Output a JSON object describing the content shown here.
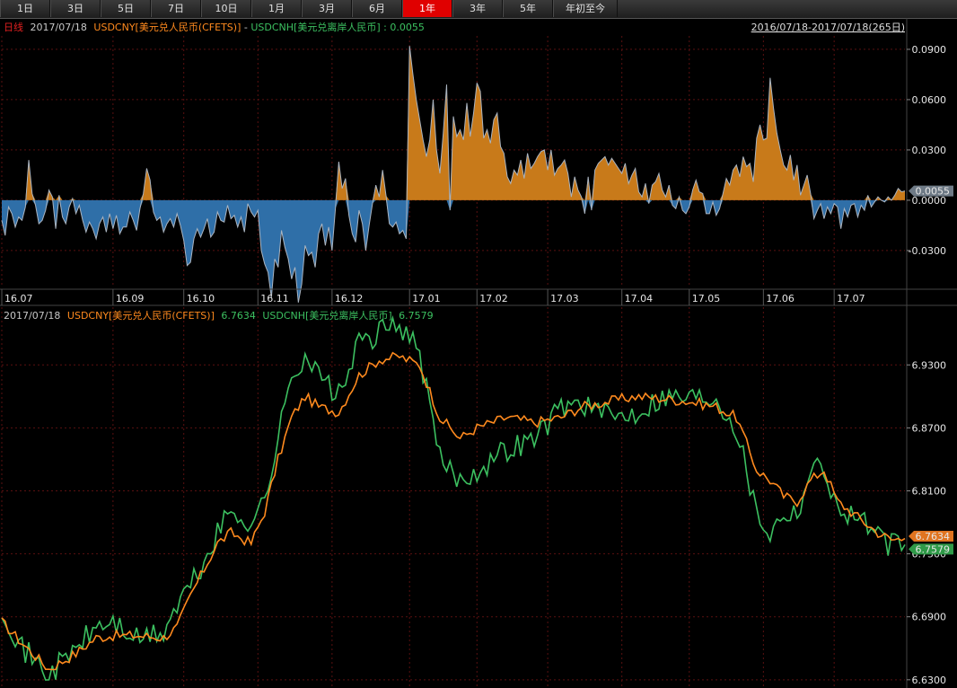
{
  "tabs": [
    {
      "label": "1日"
    },
    {
      "label": "3日"
    },
    {
      "label": "5日"
    },
    {
      "label": "7日"
    },
    {
      "label": "10日"
    },
    {
      "label": "1月"
    },
    {
      "label": "3月"
    },
    {
      "label": "6月"
    },
    {
      "label": "1年",
      "active": true
    },
    {
      "label": "3年"
    },
    {
      "label": "5年"
    },
    {
      "label": "年初至今"
    }
  ],
  "colors": {
    "cny": "#ff8a1e",
    "cnh": "#3cc060",
    "pos": "#c87a1a",
    "neg": "#2f6fa8",
    "red": "#e02020",
    "grid": "#5a1010"
  },
  "chart_data": [
    {
      "type": "area",
      "header": {
        "prefix": "日线",
        "date": "2017/07/18",
        "series_a": "USDCNY[美元兑人民币(CFETS)]",
        "sep": " - ",
        "series_b": "USDCNH[美元兑离岸人民币]",
        "value_text": ": 0.0055",
        "range": "2016/07/18-2017/07/18(265日)"
      },
      "ylim": [
        -0.052,
        0.098
      ],
      "yticks": [
        {
          "v": 0.09,
          "label": "0.0900"
        },
        {
          "v": 0.06,
          "label": "0.0600"
        },
        {
          "v": 0.03,
          "label": "0.0300"
        },
        {
          "v": 0.0,
          "label": "0.0000"
        },
        {
          "v": -0.03,
          "label": "-0.0300"
        }
      ],
      "last_value": {
        "v": 0.0055,
        "label": "0.0055"
      },
      "xticks": [
        {
          "i": 0,
          "label": "16.07"
        },
        {
          "i": 33,
          "label": "16.09"
        },
        {
          "i": 54,
          "label": "16.10"
        },
        {
          "i": 76,
          "label": "16.11"
        },
        {
          "i": 98,
          "label": "16.12"
        },
        {
          "i": 121,
          "label": "17.01"
        },
        {
          "i": 141,
          "label": "17.02"
        },
        {
          "i": 162,
          "label": "17.03"
        },
        {
          "i": 184,
          "label": "17.04"
        },
        {
          "i": 204,
          "label": "17.05"
        },
        {
          "i": 226,
          "label": "17.06"
        },
        {
          "i": 247,
          "label": "17.07"
        }
      ],
      "values": [
        -0.012,
        -0.021,
        -0.004,
        -0.008,
        -0.016,
        -0.01,
        -0.012,
        -0.004,
        0.024,
        0.004,
        -0.003,
        -0.014,
        -0.012,
        -0.006,
        0.006,
        0.002,
        -0.017,
        0.003,
        -0.01,
        -0.014,
        -0.004,
        0.001,
        -0.008,
        -0.003,
        -0.012,
        -0.019,
        -0.013,
        -0.017,
        -0.023,
        -0.014,
        -0.01,
        -0.019,
        -0.008,
        -0.017,
        -0.009,
        -0.02,
        -0.016,
        -0.016,
        -0.007,
        -0.012,
        -0.018,
        -0.005,
        0.004,
        0.019,
        0.012,
        -0.007,
        -0.012,
        -0.01,
        -0.019,
        -0.014,
        -0.011,
        -0.016,
        -0.008,
        -0.015,
        -0.024,
        -0.039,
        -0.037,
        -0.023,
        -0.017,
        -0.022,
        -0.017,
        -0.011,
        -0.022,
        -0.019,
        -0.007,
        -0.012,
        -0.013,
        -0.003,
        -0.011,
        -0.009,
        -0.016,
        -0.01,
        -0.019,
        -0.002,
        -0.007,
        -0.01,
        -0.006,
        -0.03,
        -0.038,
        -0.043,
        -0.058,
        -0.035,
        -0.04,
        -0.018,
        -0.028,
        -0.035,
        -0.047,
        -0.04,
        -0.061,
        -0.05,
        -0.027,
        -0.033,
        -0.031,
        -0.04,
        -0.02,
        -0.014,
        -0.027,
        -0.016,
        -0.03,
        -0.005,
        0.023,
        0.007,
        0.013,
        -0.009,
        -0.02,
        -0.025,
        -0.006,
        -0.014,
        -0.03,
        -0.015,
        -0.002,
        0.009,
        0.002,
        0.018,
        0.003,
        -0.014,
        -0.016,
        -0.013,
        -0.02,
        -0.018,
        -0.023,
        0.092,
        0.075,
        0.06,
        0.048,
        0.036,
        0.026,
        0.036,
        0.06,
        0.03,
        0.016,
        0.04,
        0.069,
        -0.006,
        0.05,
        0.038,
        0.042,
        0.036,
        0.058,
        0.038,
        0.052,
        0.07,
        0.065,
        0.037,
        0.042,
        0.034,
        0.048,
        0.052,
        0.032,
        0.028,
        0.014,
        0.01,
        0.018,
        0.015,
        0.024,
        0.013,
        0.028,
        0.019,
        0.022,
        0.026,
        0.029,
        0.03,
        0.018,
        0.03,
        0.015,
        0.019,
        0.021,
        0.024,
        0.016,
        0.002,
        0.014,
        0.006,
        0.002,
        -0.008,
        0.014,
        -0.006,
        0.018,
        0.022,
        0.024,
        0.026,
        0.021,
        0.025,
        0.022,
        0.019,
        0.016,
        0.022,
        0.01,
        0.015,
        0.019,
        0.005,
        0.002,
        0.01,
        -0.002,
        0.009,
        0.011,
        0.016,
        0.006,
        0.002,
        0.009,
        -0.003,
        -0.005,
        0.002,
        -0.006,
        -0.008,
        -0.004,
        0.006,
        0.012,
        0.005,
        0.004,
        -0.008,
        -0.008,
        -0.001,
        -0.009,
        -0.005,
        0.004,
        0.013,
        0.009,
        0.018,
        0.021,
        0.014,
        0.026,
        0.02,
        0.022,
        0.011,
        0.037,
        0.045,
        0.036,
        0.037,
        0.073,
        0.055,
        0.04,
        0.03,
        0.021,
        0.018,
        0.027,
        0.012,
        0.021,
        0.003,
        0.009,
        0.015,
        0.004,
        -0.011,
        -0.006,
        -0.002,
        -0.011,
        -0.004,
        -0.008,
        -0.002,
        -0.004,
        -0.017,
        -0.005,
        -0.01,
        -0.003,
        -0.002,
        -0.01,
        -0.003,
        -0.006,
        0.003,
        -0.004,
        -0.001,
        0.002,
        0.0,
        -0.001,
        0.002,
        0.0,
        0.003,
        0.007,
        0.005,
        0.0055
      ]
    },
    {
      "type": "line",
      "header": {
        "date": "2017/07/18",
        "series_a_label": "USDCNY[美元兑人民币(CFETS)]",
        "series_a_value": "6.7634",
        "series_b_label": "USDCNH[美元兑离岸人民币]",
        "series_b_value": "6.7579"
      },
      "ylim": [
        6.623,
        6.985
      ],
      "yticks": [
        {
          "v": 6.93,
          "label": "6.9300"
        },
        {
          "v": 6.87,
          "label": "6.8700"
        },
        {
          "v": 6.81,
          "label": "6.8100"
        },
        {
          "v": 6.75,
          "label": "6.7500"
        },
        {
          "v": 6.69,
          "label": "6.6900"
        },
        {
          "v": 6.63,
          "label": "6.6300"
        }
      ],
      "last_values": [
        {
          "v": 6.7634,
          "label": "6.7634",
          "series": "cny"
        },
        {
          "v": 6.7579,
          "label": "6.7579",
          "series": "cnh"
        }
      ],
      "anchors_cny": [
        [
          0,
          6.685
        ],
        [
          6,
          6.665
        ],
        [
          14,
          6.64
        ],
        [
          22,
          6.655
        ],
        [
          28,
          6.67
        ],
        [
          33,
          6.672
        ],
        [
          40,
          6.672
        ],
        [
          48,
          6.67
        ],
        [
          52,
          6.68
        ],
        [
          56,
          6.71
        ],
        [
          60,
          6.735
        ],
        [
          64,
          6.76
        ],
        [
          68,
          6.77
        ],
        [
          74,
          6.76
        ],
        [
          78,
          6.79
        ],
        [
          82,
          6.84
        ],
        [
          86,
          6.88
        ],
        [
          90,
          6.9
        ],
        [
          94,
          6.89
        ],
        [
          100,
          6.885
        ],
        [
          106,
          6.92
        ],
        [
          112,
          6.935
        ],
        [
          118,
          6.938
        ],
        [
          124,
          6.93
        ],
        [
          130,
          6.88
        ],
        [
          136,
          6.86
        ],
        [
          141,
          6.87
        ],
        [
          150,
          6.88
        ],
        [
          158,
          6.875
        ],
        [
          166,
          6.88
        ],
        [
          172,
          6.89
        ],
        [
          180,
          6.895
        ],
        [
          188,
          6.9
        ],
        [
          196,
          6.898
        ],
        [
          204,
          6.895
        ],
        [
          212,
          6.89
        ],
        [
          218,
          6.88
        ],
        [
          224,
          6.83
        ],
        [
          228,
          6.82
        ],
        [
          232,
          6.805
        ],
        [
          236,
          6.8
        ],
        [
          240,
          6.82
        ],
        [
          244,
          6.83
        ],
        [
          248,
          6.8
        ],
        [
          252,
          6.79
        ],
        [
          256,
          6.78
        ],
        [
          260,
          6.77
        ],
        [
          264,
          6.7634
        ]
      ],
      "anchors_cnh": [
        [
          0,
          6.7
        ],
        [
          6,
          6.66
        ],
        [
          14,
          6.635
        ],
        [
          22,
          6.66
        ],
        [
          28,
          6.68
        ],
        [
          33,
          6.685
        ],
        [
          40,
          6.668
        ],
        [
          48,
          6.675
        ],
        [
          52,
          6.7
        ],
        [
          56,
          6.72
        ],
        [
          60,
          6.74
        ],
        [
          64,
          6.77
        ],
        [
          68,
          6.79
        ],
        [
          74,
          6.78
        ],
        [
          78,
          6.8
        ],
        [
          82,
          6.86
        ],
        [
          86,
          6.92
        ],
        [
          90,
          6.94
        ],
        [
          94,
          6.92
        ],
        [
          100,
          6.9
        ],
        [
          106,
          6.95
        ],
        [
          112,
          6.96
        ],
        [
          118,
          6.97
        ],
        [
          124,
          6.94
        ],
        [
          130,
          6.84
        ],
        [
          136,
          6.82
        ],
        [
          141,
          6.83
        ],
        [
          150,
          6.85
        ],
        [
          158,
          6.86
        ],
        [
          166,
          6.89
        ],
        [
          172,
          6.895
        ],
        [
          180,
          6.88
        ],
        [
          188,
          6.885
        ],
        [
          196,
          6.9
        ],
        [
          204,
          6.9
        ],
        [
          212,
          6.9
        ],
        [
          218,
          6.87
        ],
        [
          224,
          6.79
        ],
        [
          228,
          6.77
        ],
        [
          232,
          6.79
        ],
        [
          236,
          6.79
        ],
        [
          240,
          6.83
        ],
        [
          244,
          6.835
        ],
        [
          248,
          6.79
        ],
        [
          252,
          6.79
        ],
        [
          256,
          6.78
        ],
        [
          260,
          6.765
        ],
        [
          264,
          6.7579
        ]
      ]
    }
  ]
}
